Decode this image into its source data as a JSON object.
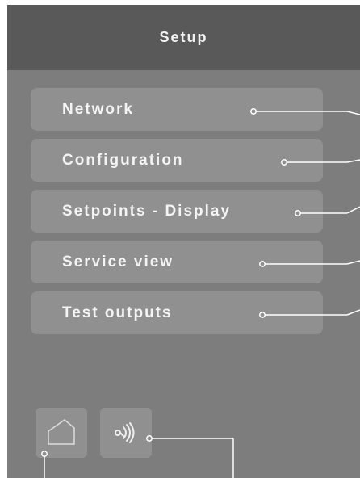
{
  "header": {
    "title": "Setup"
  },
  "menu": {
    "items": [
      {
        "label": "Network"
      },
      {
        "label": "Configuration"
      },
      {
        "label": "Setpoints - Display"
      },
      {
        "label": "Service view"
      },
      {
        "label": "Test outputs"
      }
    ]
  },
  "bottom_bar": {
    "home_icon": "home-icon",
    "touch_icon": "touch-sound-icon"
  },
  "colors": {
    "screen_background": "#7d7d7d",
    "header_background": "#595959",
    "button_background": "#909090",
    "text": "#f4f4f4",
    "callout_line": "#ffffff"
  }
}
